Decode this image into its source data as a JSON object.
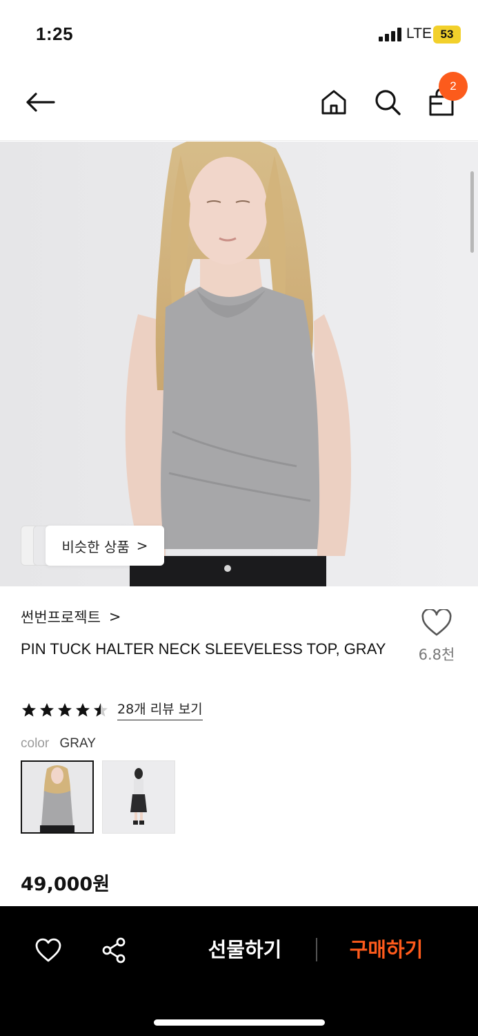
{
  "status_bar": {
    "time": "1:25",
    "network": "LTE",
    "battery": "53"
  },
  "header": {
    "back_icon": "arrow-left-icon",
    "home_icon": "home-icon",
    "search_icon": "search-icon",
    "cart_icon": "shopping-bag-icon",
    "cart_count": "2"
  },
  "hero": {
    "similar_products_label": "비슷한 상품",
    "similar_chevron": ">"
  },
  "product": {
    "brand": "썬번프로젝트",
    "brand_chevron": ">",
    "title": "PIN TUCK HALTER NECK SLEEVELESS TOP, GRAY",
    "like_count": "6.8천",
    "rating": 4.5,
    "review_link": "28개 리뷰 보기",
    "color_label": "color",
    "color_value": "GRAY",
    "swatches": [
      "GRAY front",
      "full look"
    ],
    "price": "49,000원"
  },
  "bottom_bar": {
    "like_icon": "heart-icon",
    "share_icon": "share-icon",
    "gift_label": "선물하기",
    "buy_label": "구매하기"
  },
  "colors": {
    "accent": "#fc5b1c",
    "buy_text": "#ff5b1c",
    "bar_bg": "#000000"
  }
}
